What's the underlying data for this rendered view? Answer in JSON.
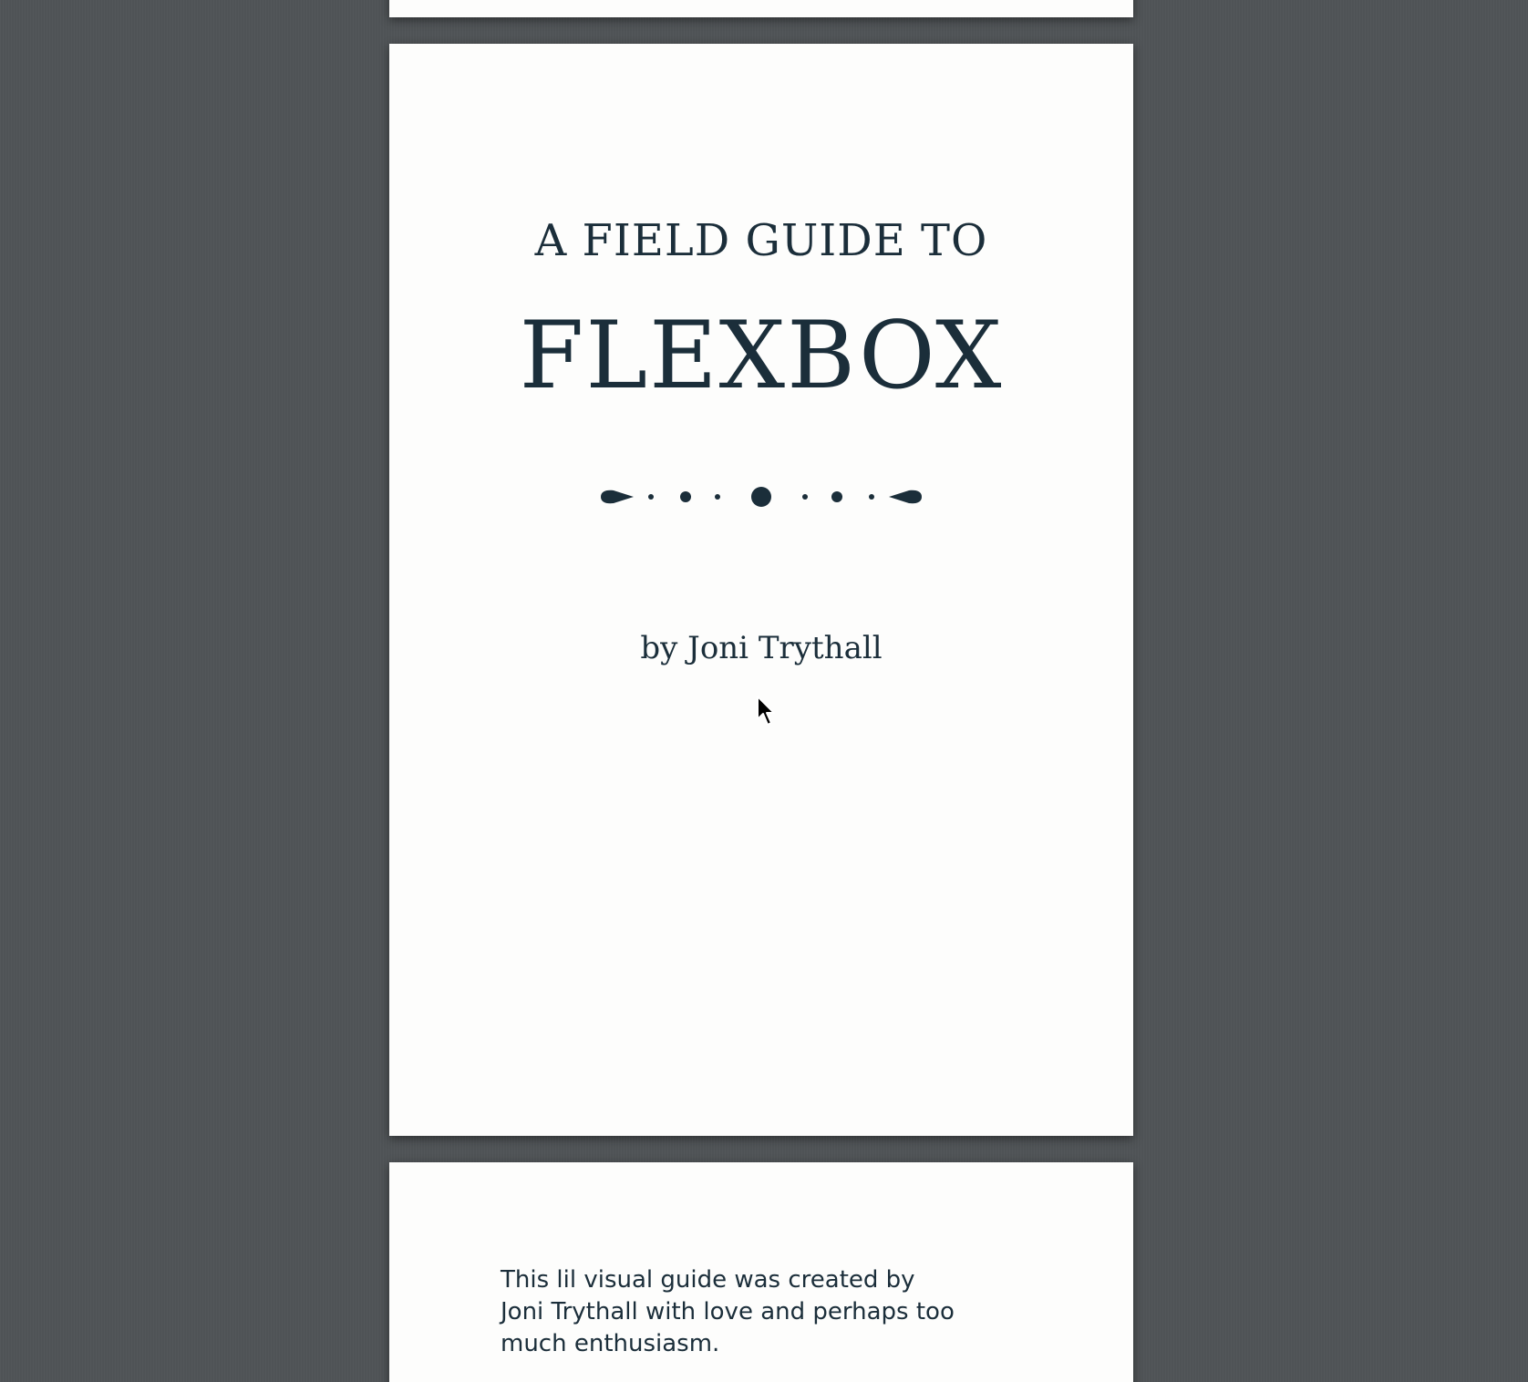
{
  "cover": {
    "subtitle": "A FIELD GUIDE TO",
    "title": "FLEXBOX",
    "author": "by Joni Trythall",
    "ornament_icon": "ornamental-divider-icon"
  },
  "next_page": {
    "intro": "This lil visual guide was created by Joni Trythall with love and perhaps too much enthusiasm."
  },
  "colors": {
    "background": "#4f5356",
    "page": "#fdfdfc",
    "ink": "#1b2e3a"
  }
}
